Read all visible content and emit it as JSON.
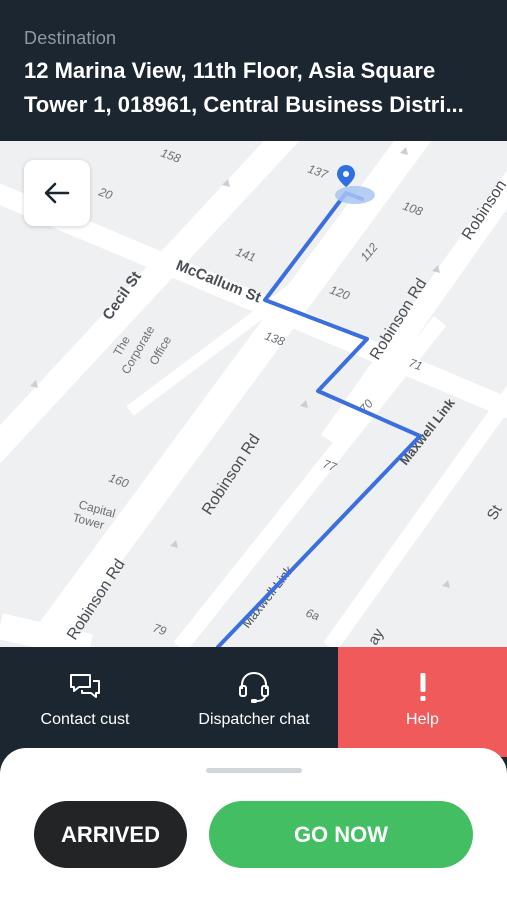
{
  "header": {
    "destination_label": "Destination",
    "address_line1": "12 Marina View, 11th Floor, Asia Square",
    "address_line2": "Tower 1, 018961, Central Business Distri..."
  },
  "map": {
    "street_labels": {
      "cecil": "Cecil St",
      "mccallum": "McCallum St",
      "robinson_a": "Robinson Rd",
      "robinson_b": "Robinson Rd",
      "robinson_c": "Robinson Rd",
      "robinson_d": "Robinson",
      "maxwell_a": "Maxwell Link",
      "maxwell_b": "Maxwell Link",
      "st_partial": "St",
      "ay_partial": "ay",
      "corporate_office_1": "The",
      "corporate_office_2": "Corporate",
      "corporate_office_3": "Office",
      "capital_tower_1": "Capital",
      "capital_tower_2": "Tower"
    },
    "building_numbers": {
      "n158": "158",
      "n20": "20",
      "n137": "137",
      "n108": "108",
      "n141": "141",
      "n112": "112",
      "n120": "120",
      "n138": "138",
      "n71": "71",
      "n70": "70",
      "n77": "77",
      "n160": "160",
      "n79": "79",
      "n6a": "6a"
    },
    "colors": {
      "route": "#3b6fe0",
      "pin": "#2f6fe4",
      "road": "#ffffff",
      "block": "#eef0f1"
    },
    "back_icon": "arrow-left-icon"
  },
  "actions": {
    "contact": {
      "label": "Contact cust",
      "icon": "chat-bubbles-icon"
    },
    "dispatcher": {
      "label": "Dispatcher chat",
      "icon": "headset-icon"
    },
    "help": {
      "label": "Help",
      "icon": "exclamation-icon"
    }
  },
  "sheet": {
    "arrived_label": "ARRIVED",
    "go_now_label": "GO NOW"
  }
}
